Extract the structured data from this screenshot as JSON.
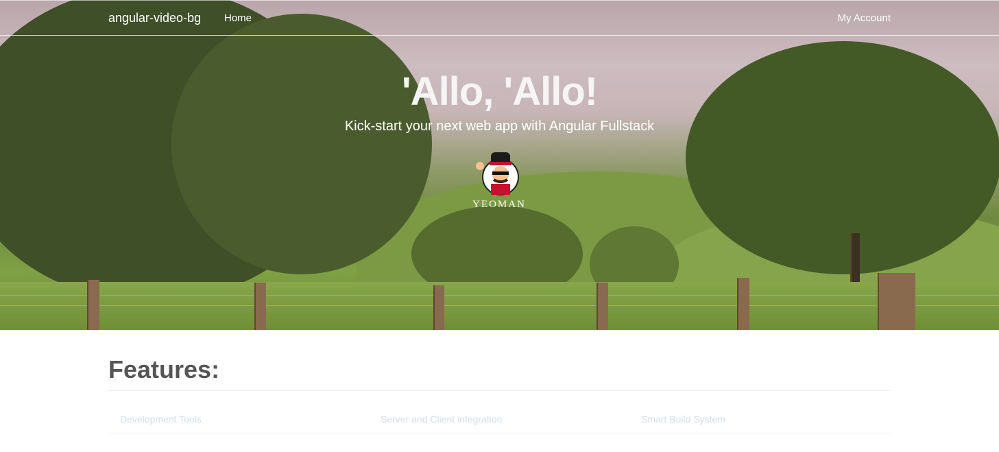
{
  "navbar": {
    "brand": "angular-video-bg",
    "home_label": "Home",
    "account_label": "My Account"
  },
  "hero": {
    "headline": "'Allo, 'Allo!",
    "lead": "Kick-start your next web app with Angular Fullstack",
    "logo_text": "YEOMAN"
  },
  "features": {
    "title": "Features:",
    "items": [
      "Development Tools",
      "Server and Client integration",
      "Smart Build System"
    ]
  },
  "colors": {
    "sky": "#c9b8bc",
    "grass": "#7fa043",
    "feature_link": "#cfe0ec",
    "title": "#555555"
  }
}
